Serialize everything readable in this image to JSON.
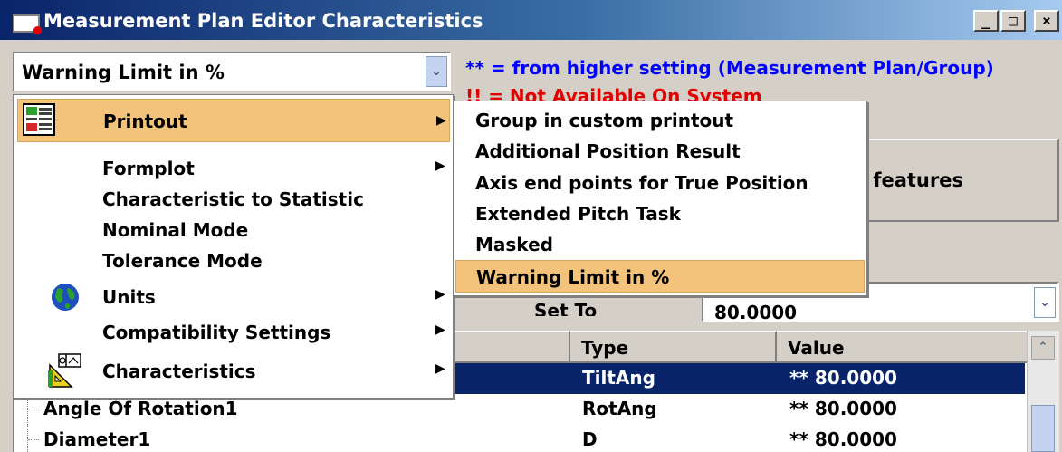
{
  "window": {
    "title": "Measurement Plan Editor Characteristics",
    "minimize_glyph": "_",
    "maximize_glyph": "□",
    "close_glyph": "×"
  },
  "combo": {
    "value": "Warning Limit in %",
    "arrow": "⌄"
  },
  "notes": {
    "blue": "** = from higher setting (Measurement Plan/Group)",
    "red": "!! = Not Available On System"
  },
  "background_button": {
    "partial_label": "d features"
  },
  "set_to": {
    "label": "Set To",
    "value": "80.0000",
    "arrow": "⌄"
  },
  "table": {
    "headers": {
      "type": "Type",
      "value": "Value"
    },
    "rows": [
      {
        "name": "",
        "type": "TiltAng",
        "value": "** 80.0000",
        "selected": true
      },
      {
        "name": "Angle Of Rotation1",
        "type": "RotAng",
        "value": "** 80.0000",
        "selected": false
      },
      {
        "name": "Diameter1",
        "type": "D",
        "value": "** 80.0000",
        "selected": false
      }
    ],
    "scroll_up": "⌃"
  },
  "menu": {
    "submenu_arrow": "▶",
    "items": [
      {
        "label": "Printout",
        "icon": "printout-icon",
        "has_submenu": true,
        "active": true
      },
      {
        "label": "Formplot",
        "icon": "",
        "has_submenu": true
      },
      {
        "label": "Characteristic to Statistic",
        "icon": "",
        "has_submenu": false
      },
      {
        "label": "Nominal Mode",
        "icon": "",
        "has_submenu": false
      },
      {
        "label": "Tolerance Mode",
        "icon": "",
        "has_submenu": false
      },
      {
        "label": "Units",
        "icon": "globe-icon",
        "has_submenu": true
      },
      {
        "label": "Compatibility Settings",
        "icon": "",
        "has_submenu": true
      },
      {
        "label": "Characteristics",
        "icon": "characteristics-icon",
        "has_submenu": true
      }
    ]
  },
  "submenu": {
    "items": [
      {
        "label": "Group in custom printout"
      },
      {
        "label": "Additional Position Result"
      },
      {
        "label": "Axis end points for True Position"
      },
      {
        "label": "Extended Pitch Task"
      },
      {
        "label": "Masked"
      },
      {
        "label": "Warning Limit in %",
        "highlighted": true
      }
    ]
  },
  "colors": {
    "accent_highlight": "#f3c27b",
    "selection": "#0a246a",
    "note_blue": "#0000ff",
    "note_red": "#e00000",
    "title_bar": "#0a246a"
  }
}
